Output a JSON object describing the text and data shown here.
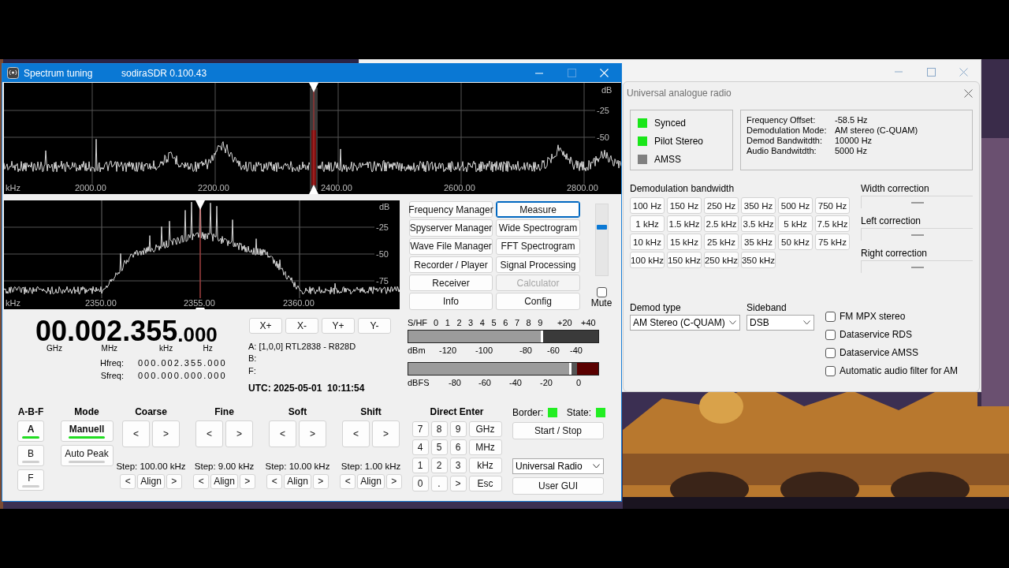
{
  "main_window": {
    "title": "Spectrum tuning",
    "app_version": "sodiraSDR 0.100.43"
  },
  "spectrum_overview": {
    "unit_db": "dB",
    "db_labels": [
      "-25",
      "-50"
    ],
    "unit_khz": "kHz",
    "freq_labels": [
      "2000.00",
      "2200.00",
      "2400.00",
      "2600.00",
      "2800.00"
    ]
  },
  "spectrum_zoom": {
    "unit_db": "dB",
    "db_labels": [
      "-25",
      "-50",
      "-75"
    ],
    "unit_khz": "kHz",
    "freq_labels": [
      "2350.00",
      "2355.00",
      "2360.00"
    ]
  },
  "tool_buttons": [
    {
      "label": "Frequency Manager",
      "selected": false,
      "disabled": false
    },
    {
      "label": "Measure",
      "selected": true,
      "disabled": false
    },
    {
      "label": "Spyserver Manager",
      "selected": false,
      "disabled": false
    },
    {
      "label": "Wide Spectrogram",
      "selected": false,
      "disabled": false
    },
    {
      "label": "Wave File Manager",
      "selected": false,
      "disabled": false
    },
    {
      "label": "FFT Spectrogram",
      "selected": false,
      "disabled": false
    },
    {
      "label": "Recorder / Player",
      "selected": false,
      "disabled": false
    },
    {
      "label": "Signal Processing",
      "selected": false,
      "disabled": false
    },
    {
      "label": "Receiver",
      "selected": false,
      "disabled": false
    },
    {
      "label": "Calculator",
      "selected": false,
      "disabled": true
    },
    {
      "label": "Info",
      "selected": false,
      "disabled": false
    },
    {
      "label": "Config",
      "selected": false,
      "disabled": false
    }
  ],
  "volume": {
    "level": 0.7
  },
  "mute": {
    "label": "Mute",
    "checked": false
  },
  "frequency_display": {
    "segments": [
      {
        "digits": "00",
        "unit": "GHz"
      },
      {
        "digits": ".002",
        "unit": "MHz"
      },
      {
        "digits": ".355",
        "unit": "kHz"
      },
      {
        "digits": ".000",
        "unit": "Hz"
      }
    ]
  },
  "readouts": [
    {
      "label": "Hfreq:",
      "value": "000.002.355.000"
    },
    {
      "label": "Sfreq:",
      "value": "000.000.000.000"
    }
  ],
  "axis_buttons": [
    "X+",
    "X-",
    "Y+",
    "Y-"
  ],
  "devices": [
    {
      "slot": "A:",
      "name": "[1,0,0] RTL2838 - R828D"
    },
    {
      "slot": "B:"
    },
    {
      "slot": "F:"
    }
  ],
  "utc": "UTC: 2025-05-01  10:11:54",
  "s_meter": {
    "top_labels": [
      "S/HF",
      "0",
      "1",
      "2",
      "3",
      "4",
      "5",
      "6",
      "7",
      "8",
      "9",
      "+20",
      "+40"
    ],
    "level": 0.71,
    "bottom_labels": [
      "dBm",
      "-120",
      "-100",
      "-80",
      "-60",
      "-40"
    ]
  },
  "dbfs_meter": {
    "level": 0.86,
    "labels": [
      "dBFS",
      "-80",
      "-60",
      "-40",
      "-20",
      "0"
    ]
  },
  "channel_select": {
    "title": "A-B-F",
    "options": [
      {
        "label": "A",
        "selected": true
      },
      {
        "label": "B",
        "selected": false
      },
      {
        "label": "F",
        "selected": false
      }
    ]
  },
  "mode_select": {
    "title": "Mode",
    "options": [
      {
        "label": "Manuell",
        "selected": true
      },
      {
        "label": "Auto Peak",
        "selected": false
      }
    ]
  },
  "tuners": [
    {
      "title": "Coarse",
      "buttons": [
        "<",
        ">"
      ],
      "step": "Step: 100.00 kHz",
      "align_row": [
        "<",
        "Align",
        ">"
      ]
    },
    {
      "title": "Fine",
      "buttons": [
        "<",
        ">"
      ],
      "step": "Step: 9.00 kHz",
      "align_row": [
        "<",
        "Align",
        ">"
      ]
    },
    {
      "title": "Soft",
      "buttons": [
        "<",
        ">"
      ],
      "step": "Step: 10.00 kHz",
      "align_row": [
        "<",
        "Align",
        ">"
      ]
    },
    {
      "title": "Shift",
      "buttons": [
        "<",
        ">"
      ],
      "step": "Step: 1.00 kHz",
      "align_row": [
        "<",
        "Align",
        ">"
      ]
    }
  ],
  "direct_enter": {
    "title": "Direct Enter",
    "keys": [
      "7",
      "8",
      "9",
      "GHz",
      "4",
      "5",
      "6",
      "MHz",
      "1",
      "2",
      "3",
      "kHz",
      "0",
      ".",
      ">",
      "Esc"
    ]
  },
  "indicators": [
    {
      "label": "Border:",
      "color": "#22ee22"
    },
    {
      "label": "State:",
      "color": "#22ee22"
    }
  ],
  "start_stop": "Start / Stop",
  "radio_select": "Universal Radio",
  "user_gui": "User GUI",
  "dialog": {
    "title": "Universal analogue radio",
    "status": [
      {
        "label": "Synced",
        "color": "#19e619"
      },
      {
        "label": "Pilot Stereo",
        "color": "#19e619"
      },
      {
        "label": "AMSS",
        "color": "#808080"
      }
    ],
    "info": [
      {
        "label": "Frequency Offset:",
        "value": "-58.5 Hz"
      },
      {
        "label": "Demodulation Mode:",
        "value": "AM stereo (C-QUAM)"
      },
      {
        "label": "Demod Bandwitdth:",
        "value": "10000 Hz"
      },
      {
        "label": "Audio Bandwitdth:",
        "value": "5000 Hz"
      }
    ],
    "bandwidth_title": "Demodulation bandwidth",
    "bandwidths": [
      "100 Hz",
      "150 Hz",
      "250 Hz",
      "350 Hz",
      "500 Hz",
      "750 Hz",
      "1 kHz",
      "1.5 kHz",
      "2.5 kHz",
      "3.5 kHz",
      "5 kHz",
      "7.5 kHz",
      "10 kHz",
      "15 kHz",
      "25 kHz",
      "35 kHz",
      "50 kHz",
      "75 kHz",
      "100 kHz",
      "150 kHz",
      "250 kHz",
      "350 kHz"
    ],
    "corrections": [
      {
        "label": "Width correction",
        "level": 0.5
      },
      {
        "label": "Left correction",
        "level": 0.5
      },
      {
        "label": "Right correction",
        "level": 0.5
      }
    ],
    "demod_type": {
      "label": "Demod type",
      "value": "AM Stereo (C-QUAM)"
    },
    "sideband": {
      "label": "Sideband",
      "value": "DSB"
    },
    "options": [
      {
        "label": "FM MPX stereo",
        "checked": false
      },
      {
        "label": "Dataservice RDS",
        "checked": false
      },
      {
        "label": "Dataservice AMSS",
        "checked": false
      },
      {
        "label": "Automatic audio filter for AM",
        "checked": false
      }
    ]
  }
}
